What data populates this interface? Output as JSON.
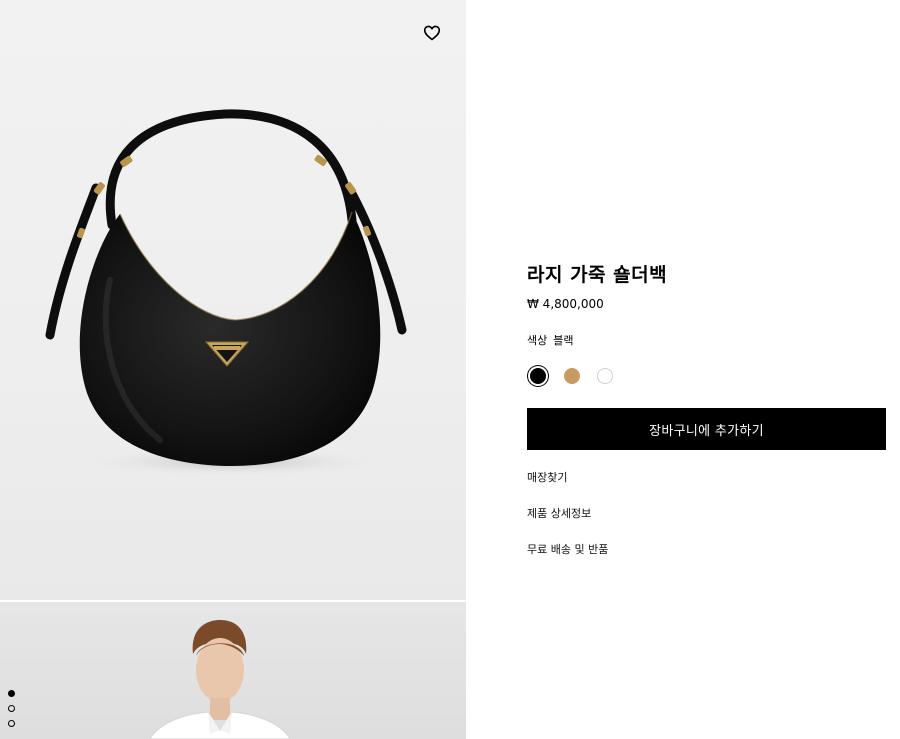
{
  "product": {
    "title": "라지 가죽 숄더백",
    "price": "₩ 4,800,000",
    "color_label": "색상",
    "color_value": "블랙"
  },
  "swatches": [
    {
      "name": "black",
      "color": "#000000",
      "selected": true
    },
    {
      "name": "tan",
      "color": "#c79b64",
      "selected": false
    },
    {
      "name": "white",
      "color": "#ffffff",
      "selected": false
    }
  ],
  "cart_button": "장바구니에 추가하기",
  "links": {
    "store_finder": "매장찾기",
    "product_details": "제품 상세정보",
    "shipping_returns": "무료 배송 및 반품"
  },
  "icons": {
    "wishlist": "heart-icon"
  },
  "gallery": {
    "active_index": 0,
    "total": 3
  }
}
